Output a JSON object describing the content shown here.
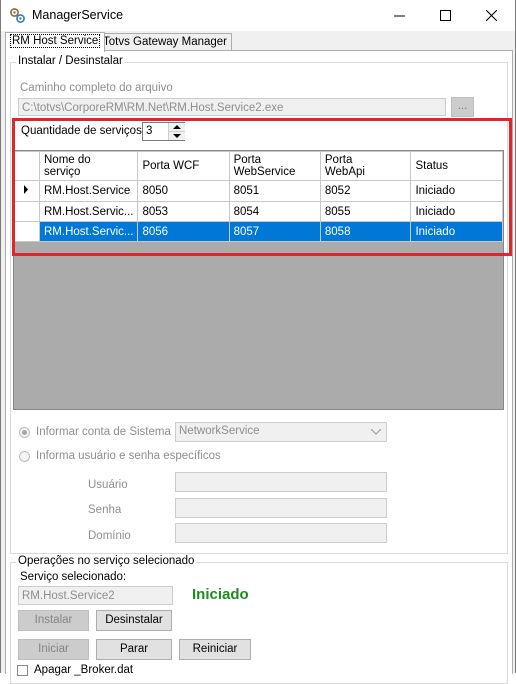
{
  "window": {
    "title": "ManagerService"
  },
  "tabs": [
    {
      "label": "RM Host Service"
    },
    {
      "label": "Totvs Gateway Manager"
    }
  ],
  "install": {
    "legend": "Instalar / Desinstalar",
    "path_label": "Caminho completo do arquivo",
    "path_value": "C:\\totvs\\CorporeRM\\RM.Net\\RM.Host.Service2.exe",
    "browse_label": "...",
    "qty_label": "Quantidade de serviços",
    "qty_value": "3"
  },
  "grid": {
    "headers": [
      {
        "l1": "Nome do",
        "l2": "serviço"
      },
      {
        "l1": "Porta WCF",
        "l2": ""
      },
      {
        "l1": "Porta",
        "l2": "WebService"
      },
      {
        "l1": "Porta",
        "l2": "WebApi"
      },
      {
        "l1": "Status",
        "l2": ""
      }
    ],
    "rows": [
      {
        "name": "RM.Host.Service",
        "wcf": "8050",
        "ws": "8051",
        "api": "8052",
        "status": "Iniciado"
      },
      {
        "name": "RM.Host.Servic...",
        "wcf": "8053",
        "ws": "8054",
        "api": "8055",
        "status": "Iniciado"
      },
      {
        "name": "RM.Host.Servic...",
        "wcf": "8056",
        "ws": "8057",
        "api": "8058",
        "status": "Iniciado"
      }
    ]
  },
  "account": {
    "system_label": "Informar conta de Sistema",
    "system_value": "NetworkService",
    "custom_label": "Informa usuário e senha específicos",
    "user_label": "Usuário",
    "password_label": "Senha",
    "domain_label": "Domínio"
  },
  "ops": {
    "legend": "Operações no serviço selecionado",
    "selected_label": "Serviço selecionado:",
    "selected_value": "RM.Host.Service2",
    "status_text": "Iniciado",
    "status_color": "#1e8c1e",
    "install_label": "Instalar",
    "uninstall_label": "Desinstalar",
    "start_label": "Iniciar",
    "stop_label": "Parar",
    "restart_label": "Reiniciar",
    "broker_label": "Apagar _Broker.dat"
  },
  "colors": {
    "selection": "#0078d7",
    "highlight": "#e0262b"
  }
}
